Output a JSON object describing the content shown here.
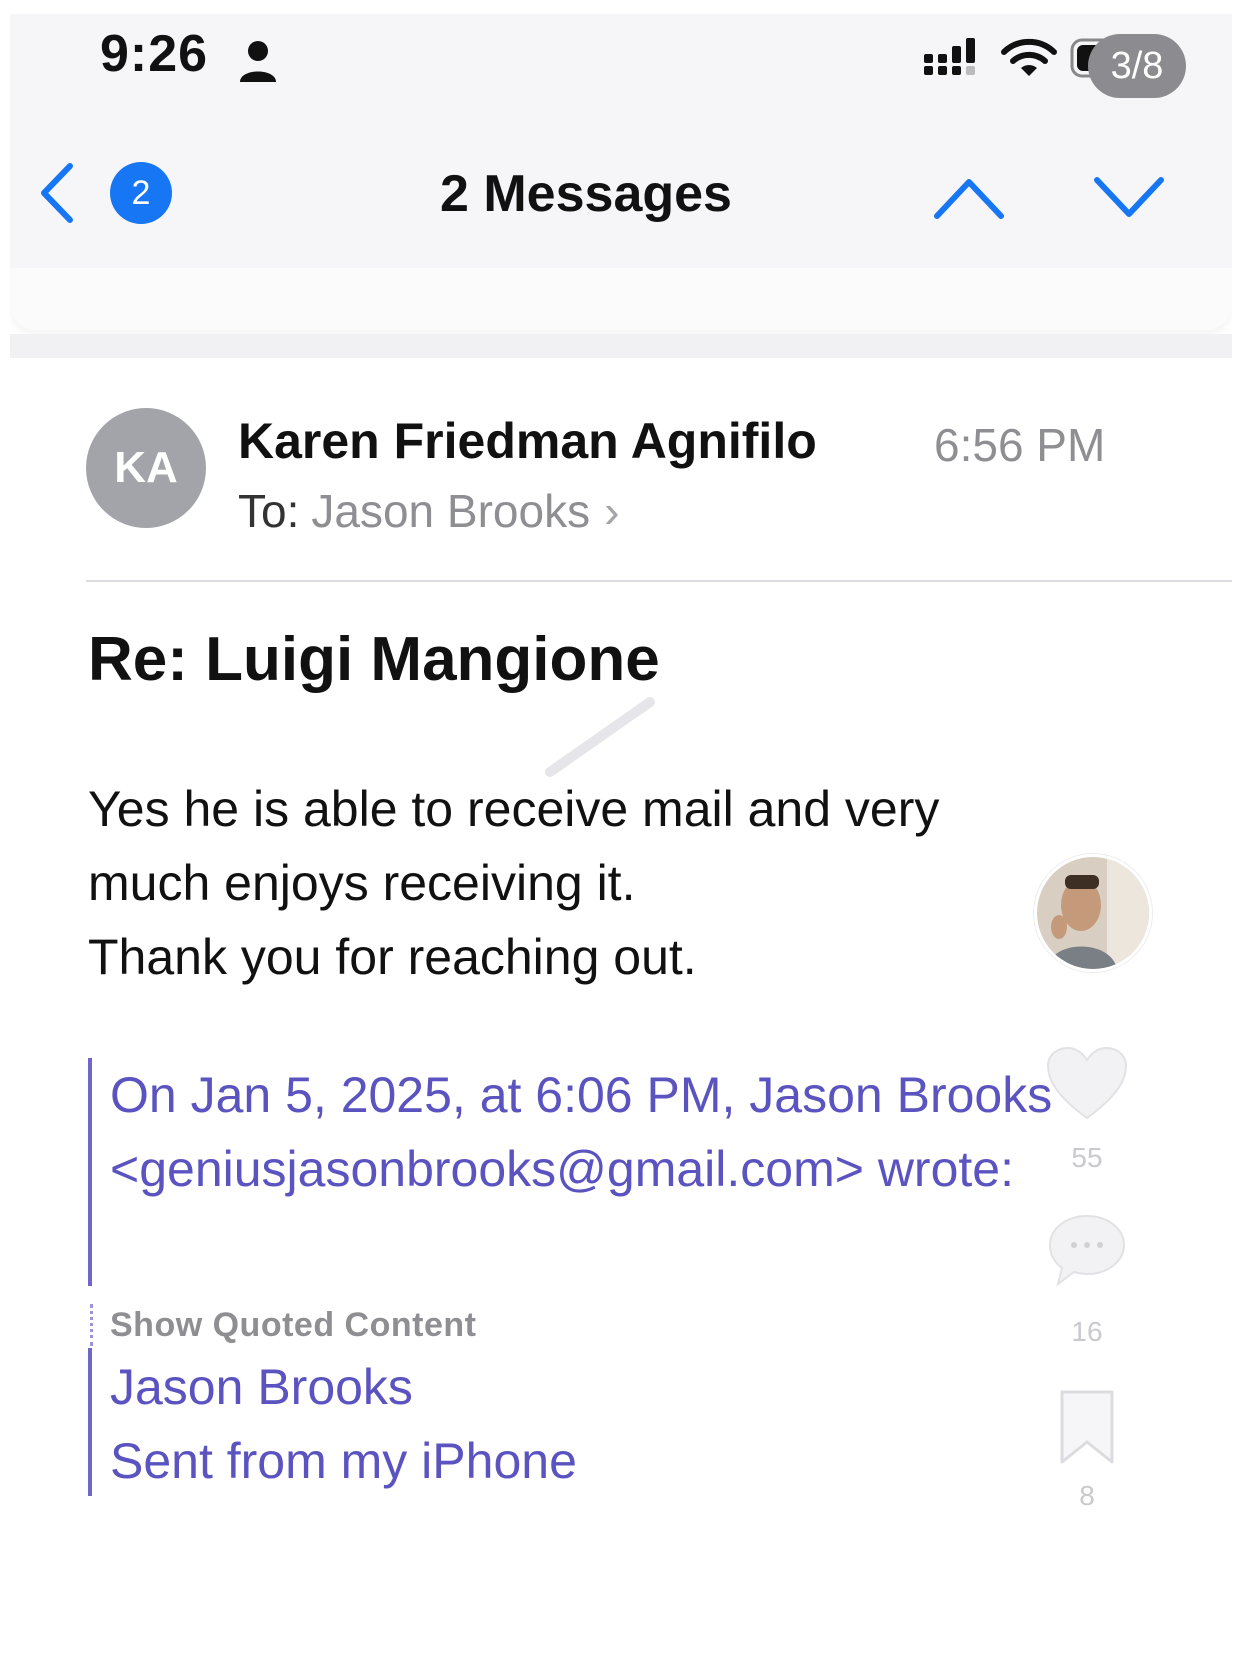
{
  "status_bar": {
    "time": "9:26",
    "icons": [
      "person-icon",
      "signal-icon",
      "wifi-icon",
      "battery-icon"
    ]
  },
  "overlay": {
    "page_counter": "3/8",
    "side_actions": [
      {
        "icon": "heart-icon",
        "count": "55"
      },
      {
        "icon": "comment-icon",
        "count": "16"
      },
      {
        "icon": "bookmark-icon",
        "count": "8"
      }
    ]
  },
  "nav": {
    "back_badge": "2",
    "title": "2 Messages"
  },
  "message": {
    "avatar_initials": "KA",
    "sender": "Karen Friedman Agnifilo",
    "time": "6:56 PM",
    "to_label": "To:",
    "to_name": "Jason Brooks",
    "subject": "Re: Luigi Mangione",
    "body_lines": [
      "Yes he is able to receive mail and very",
      "much enjoys receiving it.",
      "Thank you for reaching out."
    ],
    "quote_header_lines": [
      "On Jan 5, 2025, at 6:06 PM, Jason Brooks",
      "<geniusjasonbrooks@gmail.com> wrote:"
    ],
    "show_quoted": "Show Quoted Content",
    "signature_lines": [
      "Jason Brooks",
      "Sent from my iPhone"
    ]
  },
  "colors": {
    "accent_blue": "#1676f3",
    "quote_purple": "#5a53c0",
    "secondary_gray": "#8e8e93"
  }
}
